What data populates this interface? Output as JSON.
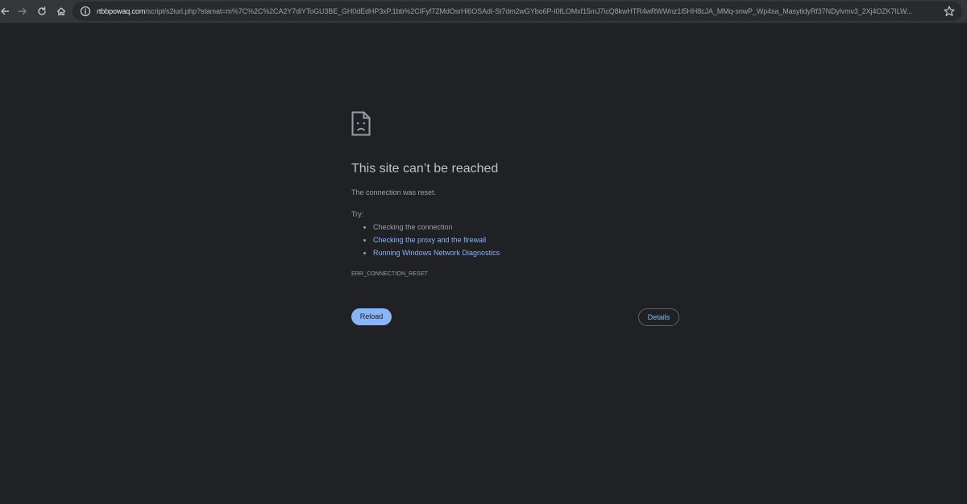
{
  "browser": {
    "url_host": "rtbbpowaq.com",
    "url_rest": "/script/s2iurl.php?stamat=m%7C%2C%2CA2Y7diYToGU3BE_GH0dEdHP3xP.1bb%2CIFyf7ZMdOsrHl6OSAdI-St7dm2wGYbo6P-I0fLOMxf15mJ7icQ8kwHTR4wRWWnz1I5HH8cJA_MMq-snwP_Wp4sa_MasytidyRf37NDylvmv3_2Xj4OZK7ILW...",
    "icons": {
      "back": "back-arrow-icon",
      "forward": "forward-arrow-icon",
      "reload": "reload-icon",
      "home": "home-icon",
      "site_info": "info-icon",
      "bookmark": "star-icon"
    }
  },
  "error_page": {
    "icon": "sad-file-icon",
    "title": "This site can’t be reached",
    "message": "The connection was reset.",
    "try_label": "Try:",
    "suggestions": [
      {
        "label": "Checking the connection",
        "is_link": false
      },
      {
        "label": "Checking the proxy and the firewall",
        "is_link": true
      },
      {
        "label": "Running Windows Network Diagnostics",
        "is_link": true
      }
    ],
    "error_code": "ERR_CONNECTION_RESET",
    "reload_label": "Reload",
    "details_label": "Details"
  },
  "colors": {
    "background": "#202124",
    "toolbar": "#35363a",
    "accent": "#8ab4f8",
    "text_primary": "#bdc1c6",
    "text_secondary": "#9aa0a6"
  }
}
